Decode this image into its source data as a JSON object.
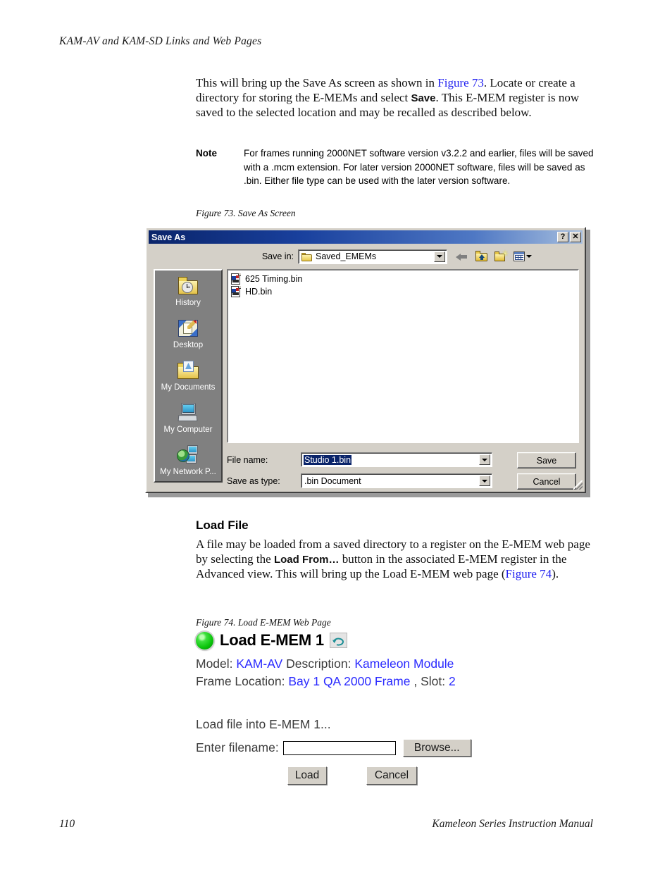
{
  "page": {
    "running_head": "KAM-AV and KAM-SD Links and Web Pages",
    "footer_page_number": "110",
    "footer_title": "Kameleon Series Instruction Manual"
  },
  "intro": {
    "part1": "This will bring up the Save As screen as shown in ",
    "link1": "Figure 73",
    "part2": ". Locate or create a directory for storing the E-MEMs and select ",
    "bold1": "Save",
    "part3": ". This E-MEM register is now saved to the selected location and may be recalled as described below."
  },
  "note": {
    "label": "Note",
    "text": "For frames running 2000NET software version v3.2.2 and earlier, files will be saved with a .mcm extension. For later version 2000NET software, files will be saved as .bin. Either file type can be used with the later version software."
  },
  "figure73": {
    "caption": "Figure 73.  Save As Screen",
    "dialog": {
      "title": "Save As",
      "help_button": "?",
      "close_button": "✕",
      "save_in_label": "Save in:",
      "save_in_value": "Saved_EMEMs",
      "files": [
        {
          "name": "625 Timing.bin"
        },
        {
          "name": "HD.bin"
        }
      ],
      "places": [
        {
          "label": "History"
        },
        {
          "label": "Desktop"
        },
        {
          "label": "My Documents"
        },
        {
          "label": "My Computer"
        },
        {
          "label": "My Network P..."
        }
      ],
      "file_name_label": "File name:",
      "file_name_value": "Studio 1.bin",
      "save_as_type_label": "Save as type:",
      "save_as_type_value": ".bin Document",
      "save_button": "Save",
      "cancel_button": "Cancel"
    }
  },
  "load_file": {
    "heading": "Load File",
    "part1": "A file may be loaded from a saved directory to a register on the E-MEM web page by selecting the ",
    "bold1": "Load From…",
    "part2": " button in the associated E-MEM register in the Advanced view. This will bring up the Load E-MEM web page (",
    "link1": "Figure 74",
    "part3": ")."
  },
  "figure74": {
    "caption": "Figure 74.  Load E-MEM Web Page",
    "webpage": {
      "title": "Load E-MEM 1",
      "model_label": "Model:",
      "model_value": "KAM-AV",
      "description_label": "Description:",
      "description_value": "Kameleon Module",
      "frame_location_label": "Frame Location:",
      "frame_location_value": "Bay 1 QA 2000 Frame",
      "slot_label": ", Slot:",
      "slot_value": "2",
      "load_into_text": "Load file into E-MEM 1...",
      "enter_filename_label": "Enter filename:",
      "filename_value": "",
      "browse_button": "Browse...",
      "load_button": "Load",
      "cancel_button": "Cancel"
    }
  },
  "colors": {
    "link": "#2a2aff",
    "title_bar_start": "#0a246a",
    "led_green": "#0ac40a",
    "dialog_face": "#d4d0c8"
  }
}
